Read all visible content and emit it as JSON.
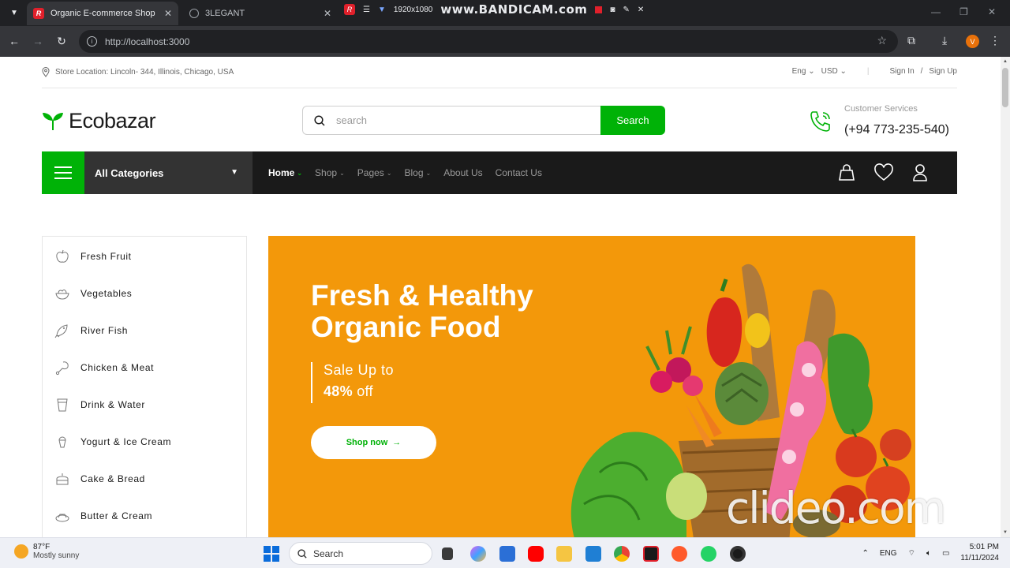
{
  "browser": {
    "tabs": [
      {
        "title": "Organic E-commerce Shop",
        "active": true
      },
      {
        "title": "3LEGANT",
        "active": false
      }
    ],
    "recorder": {
      "resolution": "1920x1080",
      "brand": "www.BANDICAM.com"
    },
    "url": "http://localhost:3000",
    "profile_initial": "V"
  },
  "topbar": {
    "location": "Store Location: Lincoln- 344, Illinois, Chicago, USA",
    "language": "Eng",
    "currency": "USD",
    "sign_in": "Sign In",
    "slash": "/",
    "sign_up": "Sign Up"
  },
  "header": {
    "brand": "Ecobazar",
    "search_placeholder": "search",
    "search_button": "Search",
    "service_label": "Customer Services",
    "service_phone": "(+94 773-235-540)"
  },
  "nav": {
    "all_categories": "All Categories",
    "links": [
      {
        "label": "Home",
        "active": true,
        "dropdown": true
      },
      {
        "label": "Shop",
        "active": false,
        "dropdown": true
      },
      {
        "label": "Pages",
        "active": false,
        "dropdown": true
      },
      {
        "label": "Blog",
        "active": false,
        "dropdown": true
      },
      {
        "label": "About Us",
        "active": false,
        "dropdown": false
      },
      {
        "label": "Contact Us",
        "active": false,
        "dropdown": false
      }
    ]
  },
  "categories": [
    {
      "label": "Fresh Fruit",
      "icon": "apple-icon"
    },
    {
      "label": "Vegetables",
      "icon": "vegetable-bowl-icon"
    },
    {
      "label": "River Fish",
      "icon": "fish-icon"
    },
    {
      "label": "Chicken & Meat",
      "icon": "chicken-leg-icon"
    },
    {
      "label": "Drink & Water",
      "icon": "water-cup-icon"
    },
    {
      "label": "Yogurt & Ice Cream",
      "icon": "ice-cream-icon"
    },
    {
      "label": "Cake & Bread",
      "icon": "cake-icon"
    },
    {
      "label": "Butter & Cream",
      "icon": "butter-icon"
    }
  ],
  "hero": {
    "title_line1": "Fresh & Healthy",
    "title_line2": "Organic Food",
    "sale_line": "Sale Up to",
    "sale_percent": "48%",
    "sale_suffix": "off",
    "cta": "Shop now",
    "colors": {
      "background": "#f3980a",
      "accent": "#00b207"
    }
  },
  "watermark": "clideo.com",
  "taskbar": {
    "temperature": "87°F",
    "weather": "Mostly sunny",
    "search": "Search",
    "language": "ENG",
    "time": "5:01 PM",
    "date": "11/11/2024"
  },
  "colors": {
    "brand_green": "#00b207",
    "nav_dark": "#1a1a1a",
    "categories_bg": "#333333"
  }
}
